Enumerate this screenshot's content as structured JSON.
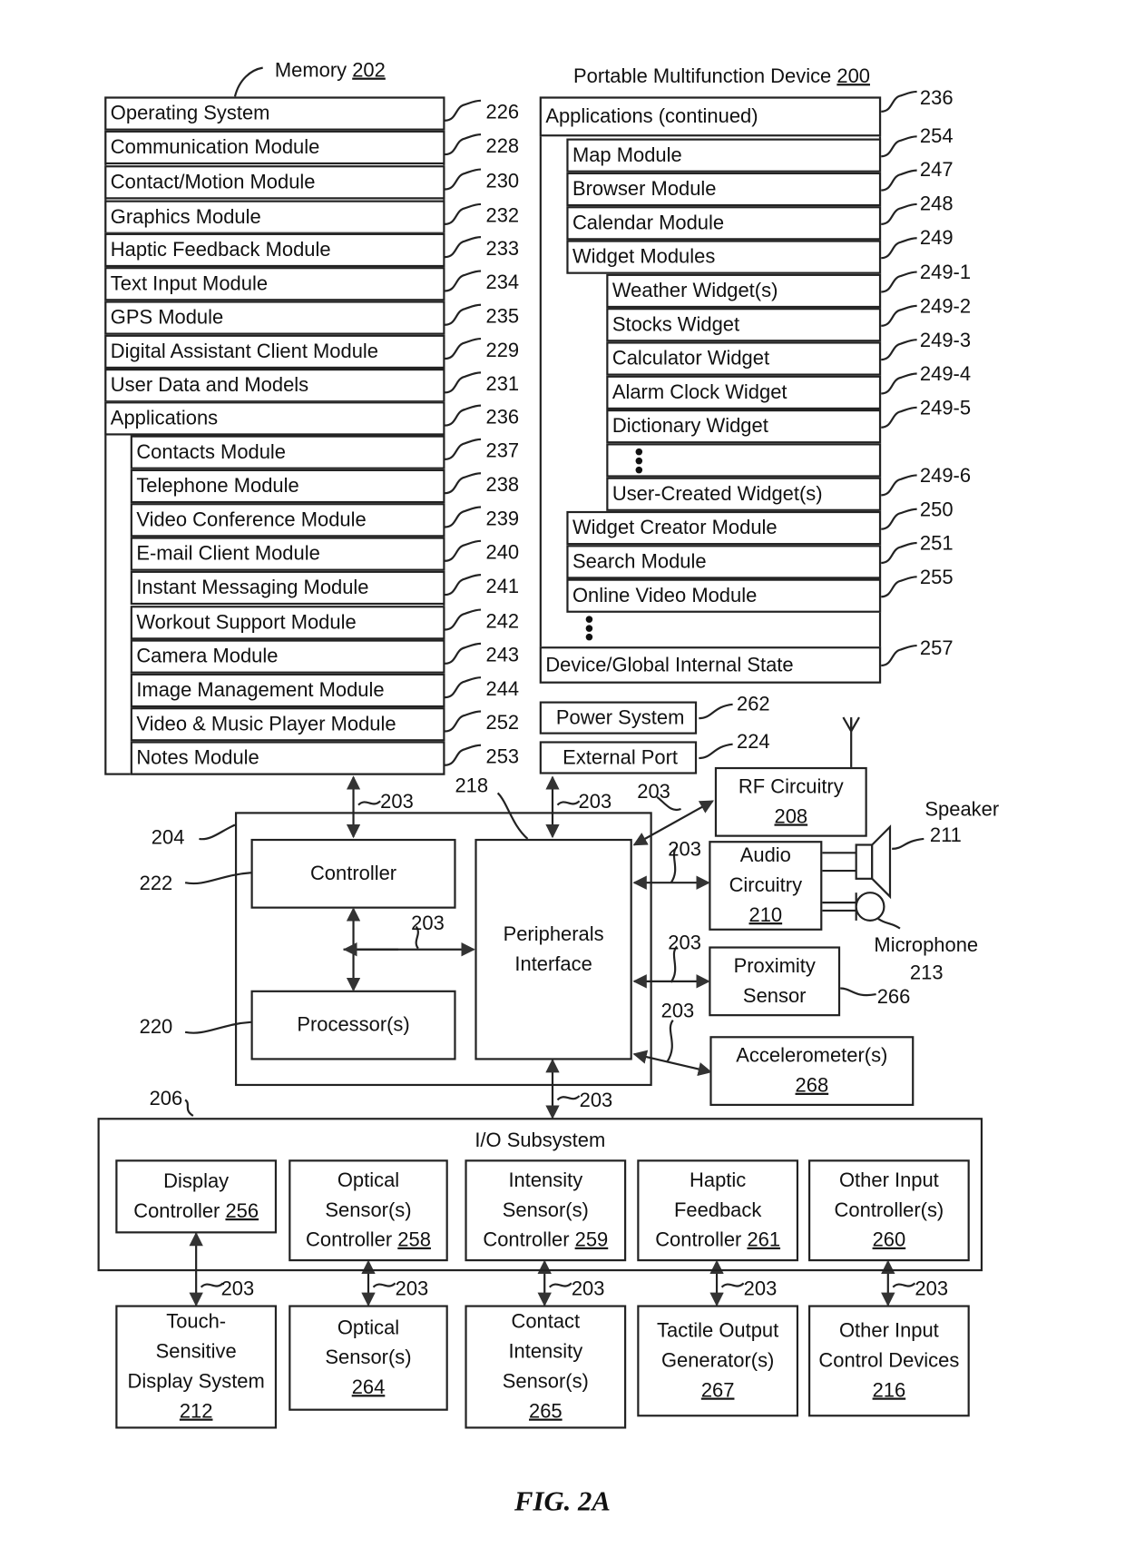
{
  "memory": {
    "title": "Memory",
    "ref": "202",
    "rows": [
      {
        "label": "Operating System",
        "ref": "226"
      },
      {
        "label": "Communication Module",
        "ref": "228"
      },
      {
        "label": "Contact/Motion Module",
        "ref": "230"
      },
      {
        "label": "Graphics Module",
        "ref": "232"
      },
      {
        "label": "Haptic Feedback Module",
        "ref": "233"
      },
      {
        "label": "Text Input Module",
        "ref": "234"
      },
      {
        "label": "GPS Module",
        "ref": "235"
      },
      {
        "label": "Digital Assistant Client Module",
        "ref": "229"
      },
      {
        "label": "User Data and Models",
        "ref": "231"
      },
      {
        "label": "Applications",
        "ref": "236"
      }
    ],
    "apps": [
      {
        "label": "Contacts Module",
        "ref": "237"
      },
      {
        "label": "Telephone Module",
        "ref": "238"
      },
      {
        "label": "Video Conference Module",
        "ref": "239"
      },
      {
        "label": "E-mail Client Module",
        "ref": "240"
      },
      {
        "label": "Instant Messaging Module",
        "ref": "241"
      },
      {
        "label": "Workout Support Module",
        "ref": "242"
      },
      {
        "label": "Camera Module",
        "ref": "243"
      },
      {
        "label": "Image Management Module",
        "ref": "244"
      },
      {
        "label": "Video & Music Player Module",
        "ref": "252"
      },
      {
        "label": "Notes Module",
        "ref": "253"
      }
    ]
  },
  "device": {
    "title": "Portable Multifunction Device",
    "ref": "200",
    "apps_continued": {
      "label": "Applications (continued)",
      "ref": "236"
    },
    "modules": [
      {
        "label": "Map Module",
        "ref": "254"
      },
      {
        "label": "Browser Module",
        "ref": "247"
      },
      {
        "label": "Calendar Module",
        "ref": "248"
      },
      {
        "label": "Widget Modules",
        "ref": "249"
      }
    ],
    "widgets": [
      {
        "label": "Weather Widget(s)",
        "ref": "249-1"
      },
      {
        "label": "Stocks Widget",
        "ref": "249-2"
      },
      {
        "label": "Calculator Widget",
        "ref": "249-3"
      },
      {
        "label": "Alarm Clock Widget",
        "ref": "249-4"
      },
      {
        "label": "Dictionary Widget",
        "ref": "249-5"
      },
      {
        "label": "User-Created Widget(s)",
        "ref": "249-6"
      }
    ],
    "more_modules": [
      {
        "label": "Widget Creator Module",
        "ref": "250"
      },
      {
        "label": "Search Module",
        "ref": "251"
      },
      {
        "label": "Online Video Module",
        "ref": "255"
      }
    ],
    "state": {
      "label": "Device/Global Internal State",
      "ref": "257"
    }
  },
  "power": {
    "label": "Power System",
    "ref": "262"
  },
  "port": {
    "label": "External Port",
    "ref": "224"
  },
  "core": {
    "ref": "204",
    "controller": {
      "label": "Controller",
      "ref": "222"
    },
    "processor": {
      "label": "Processor(s)",
      "ref": "220"
    },
    "peripherals": {
      "line1": "Peripherals",
      "line2": "Interface",
      "ref": "218"
    },
    "bus_ref": "203"
  },
  "rf": {
    "line1": "RF Circuitry",
    "ref": "208"
  },
  "audio": {
    "line1": "Audio",
    "line2": "Circuitry",
    "ref": "210"
  },
  "speaker": {
    "label": "Speaker",
    "ref": "211"
  },
  "microphone": {
    "label": "Microphone",
    "ref": "213"
  },
  "proximity": {
    "line1": "Proximity",
    "line2": "Sensor",
    "ref": "266"
  },
  "accel": {
    "line1": "Accelerometer(s)",
    "ref": "268"
  },
  "io": {
    "title": "I/O Subsystem",
    "ref": "206",
    "controllers": [
      {
        "lines": [
          "Display"
        ],
        "last": "Controller",
        "ref": "256"
      },
      {
        "lines": [
          "Optical",
          "Sensor(s)"
        ],
        "last": "Controller",
        "ref": "258"
      },
      {
        "lines": [
          "Intensity",
          "Sensor(s)"
        ],
        "last": "Controller",
        "ref": "259"
      },
      {
        "lines": [
          "Haptic",
          "Feedback"
        ],
        "last": "Controller",
        "ref": "261"
      },
      {
        "lines": [
          "Other Input",
          "Controller(s)"
        ],
        "last": "",
        "ref": "260"
      }
    ],
    "devices": [
      {
        "lines": [
          "Touch-",
          "Sensitive",
          "Display System"
        ],
        "ref": "212"
      },
      {
        "lines": [
          "Optical",
          "Sensor(s)"
        ],
        "ref": "264"
      },
      {
        "lines": [
          "Contact",
          "Intensity",
          "Sensor(s)"
        ],
        "ref": "265"
      },
      {
        "lines": [
          "Tactile Output",
          "Generator(s)"
        ],
        "ref": "267"
      },
      {
        "lines": [
          "Other Input",
          "Control Devices"
        ],
        "ref": "216"
      }
    ]
  },
  "figure_label": "FIG. 2A"
}
